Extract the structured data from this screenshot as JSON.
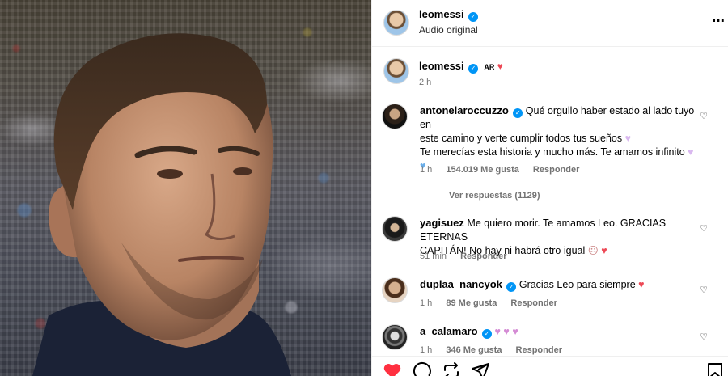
{
  "post": {
    "author": "leomessi",
    "audio_label": "Audio original",
    "caption_extra": "AR",
    "time": "2 h"
  },
  "comments": [
    {
      "user": "antonelaroccuzzo",
      "text_line1": "Qué orgullo haber estado al lado tuyo en",
      "text_line2": "este camino y verte cumplir todos tus sueños",
      "text_line3": "Te merecías esta historia y mucho más. Te amamos infinito",
      "time": "1 h",
      "likes": "154.019 Me gusta",
      "reply": "Responder",
      "view_replies": "Ver respuestas (1129)"
    },
    {
      "user": "yagisuez",
      "text_line1": "Me quiero morir. Te amamos Leo. GRACIAS ETERNAS",
      "text_line2": "CAPITÁN! No hay ni habrá otro igual",
      "time": "51 min",
      "reply": "Responder"
    },
    {
      "user": "duplaa_nancyok",
      "text_line1": "Gracias Leo para siempre",
      "time": "1 h",
      "likes": "89 Me gusta",
      "reply": "Responder"
    },
    {
      "user": "a_calamaro",
      "text_line1": "",
      "time": "1 h",
      "likes": "346 Me gusta",
      "reply": "Responder"
    }
  ],
  "icons": {
    "more": "more-options-icon",
    "verified": "verified-badge-icon",
    "heart": "heart-icon",
    "comment": "comment-icon",
    "share": "share-icon",
    "repost": "repost-icon",
    "save": "bookmark-icon"
  },
  "colors": {
    "verified": "#0095f6",
    "like_red": "#ed4956",
    "meta_gray": "#737373"
  }
}
